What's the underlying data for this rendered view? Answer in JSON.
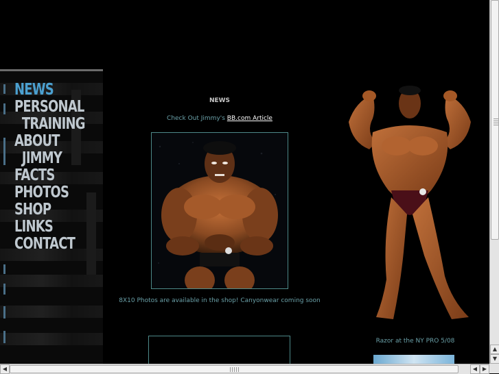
{
  "nav": {
    "items": [
      {
        "label": "NEWS",
        "active": true
      },
      {
        "label": "PERSONAL"
      },
      {
        "label": "TRAINING",
        "indent": true
      },
      {
        "label": "ABOUT"
      },
      {
        "label": "JIMMY",
        "indent": true
      },
      {
        "label": "FACTS"
      },
      {
        "label": "PHOTOS"
      },
      {
        "label": "SHOP"
      },
      {
        "label": "LINKS"
      },
      {
        "label": "CONTACT"
      }
    ]
  },
  "main": {
    "title": "NEWS",
    "checkout_prefix": "Check Out Jimmy's ",
    "checkout_link": "BB.com Article ",
    "availability": "8X10 Photos are available in the shop! Canyonwear coming soon"
  },
  "side": {
    "caption": "Razor at the NY PRO 5/08"
  },
  "colors": {
    "background": "#000000",
    "nav_active": "#4ba0d0",
    "nav_text": "#bfc8cf",
    "body_text": "#6aa0a8",
    "frame_border": "#4e8a8a"
  },
  "icons": {
    "scroll_up": "▲",
    "scroll_down": "▼",
    "scroll_left": "◀",
    "scroll_right": "▶"
  }
}
